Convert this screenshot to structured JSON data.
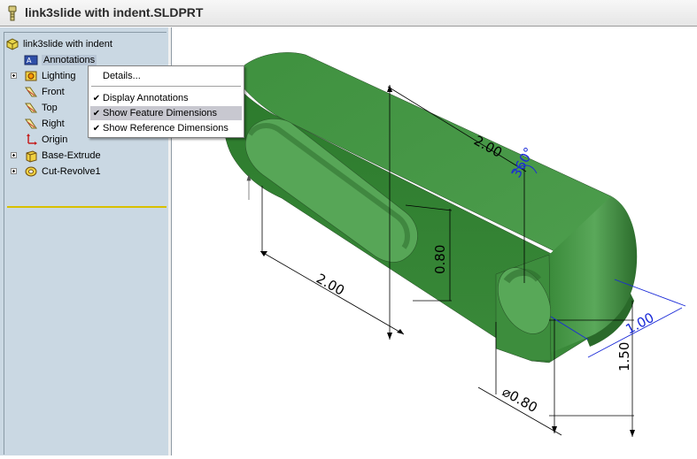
{
  "window": {
    "title": "link3slide with indent.SLDPRT"
  },
  "tree": {
    "root": "link3slide with indent",
    "items": [
      {
        "label": "Annotations",
        "icon": "annotations-icon"
      },
      {
        "label": "Lighting",
        "icon": "lighting-icon"
      },
      {
        "label": "Front",
        "icon": "plane-icon"
      },
      {
        "label": "Top",
        "icon": "plane-icon"
      },
      {
        "label": "Right",
        "icon": "plane-icon"
      },
      {
        "label": "Origin",
        "icon": "origin-icon"
      },
      {
        "label": "Base-Extrude",
        "icon": "extrude-icon"
      },
      {
        "label": "Cut-Revolve1",
        "icon": "revolve-icon"
      }
    ]
  },
  "context_menu": {
    "details": "Details...",
    "display_annotations": "Display Annotations",
    "show_feature_dimensions": "Show Feature Dimensions",
    "show_reference_dimensions": "Show Reference Dimensions"
  },
  "dimensions": {
    "top_length": "2.00",
    "slot_length": "2.00",
    "slot_width": "0.80",
    "angle": "360°",
    "radius": "1.00",
    "height": "1.50",
    "hole_diameter": "⌀0.80"
  },
  "colors": {
    "part_green": "#3a8a3a",
    "part_green_dark": "#2a6a2a",
    "part_green_light": "#59a859",
    "tree_bg": "#cad8e3",
    "highlight": "#c8c8d0",
    "dimension_blue": "#1a2ad8"
  }
}
